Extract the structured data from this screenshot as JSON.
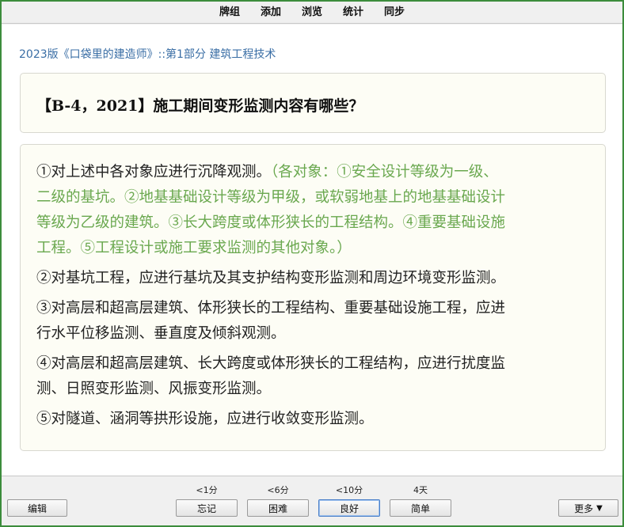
{
  "menu": [
    "牌组",
    "添加",
    "浏览",
    "统计",
    "同步"
  ],
  "deck_path": "2023版《口袋里的建造师》::第1部分 建筑工程技术",
  "question": "【B-4，2021】施工期间变形监测内容有哪些？",
  "answer": [
    {
      "lines": [
        {
          "text": "①对上述中各对象应进行沉降观测。",
          "note": "（各对象：①安全设计等级为一级、"
        },
        {
          "text": "",
          "note": "二级的基坑。②地基基础设计等级为甲级，或软弱地基上的地基基础设计"
        },
        {
          "text": "",
          "note": "等级为乙级的建筑。③长大跨度或体形狭长的工程结构。④重要基础设施"
        },
        {
          "text": "",
          "note": "工程。⑤工程设计或施工要求监测的其他对象。）"
        }
      ]
    },
    {
      "lines": [
        {
          "text": "②对基坑工程，应进行基坑及其支护结构变形监测和周边环境变形监测。",
          "note": ""
        }
      ]
    },
    {
      "lines": [
        {
          "text": "③对高层和超高层建筑、体形狭长的工程结构、重要基础设施工程，应进",
          "note": ""
        },
        {
          "text": "行水平位移监测、垂直度及倾斜观测。",
          "note": ""
        }
      ]
    },
    {
      "lines": [
        {
          "text": "④对高层和超高层建筑、长大跨度或体形狭长的工程结构，应进行扰度监",
          "note": ""
        },
        {
          "text": "测、日照变形监测、风振变形监测。",
          "note": ""
        }
      ]
    },
    {
      "lines": [
        {
          "text": "⑤对隧道、涵洞等拱形设施，应进行收敛变形监测。",
          "note": ""
        }
      ]
    }
  ],
  "bottom": {
    "edit_label": "编辑",
    "more_label": "更多",
    "more_icon": "▼",
    "answers": [
      {
        "interval": "<1分",
        "label": "忘记"
      },
      {
        "interval": "<6分",
        "label": "困难"
      },
      {
        "interval": "<10分",
        "label": "良好"
      },
      {
        "interval": "4天",
        "label": "简单"
      }
    ]
  },
  "colors": {
    "frame": "#3c8c3c",
    "deck_path": "#3a6ea5",
    "note": "#6aa84f"
  }
}
